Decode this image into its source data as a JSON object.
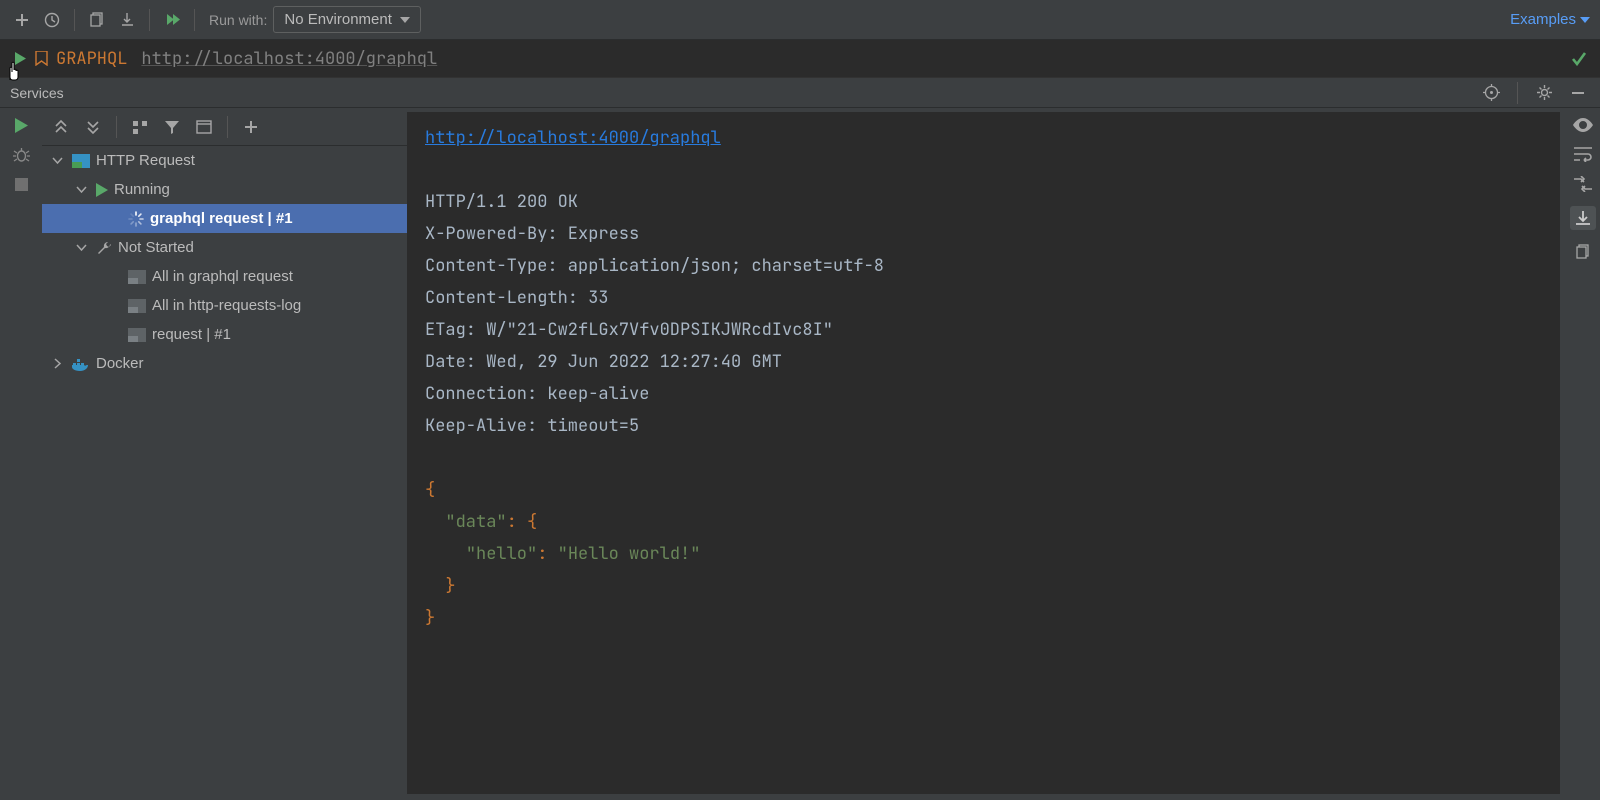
{
  "toolbar": {
    "run_with_label": "Run with:",
    "env_selected": "No Environment",
    "examples_label": "Examples"
  },
  "editor": {
    "method": "GRAPHQL",
    "url": "http://localhost:4000/graphql"
  },
  "services": {
    "title": "Services"
  },
  "tree": {
    "http_request": "HTTP Request",
    "running": "Running",
    "active_req": "graphql request  |  #1",
    "not_started": "Not Started",
    "ns_items": [
      "All in graphql request",
      "All in http-requests-log",
      "request  |  #1"
    ],
    "docker": "Docker"
  },
  "response": {
    "url": "http://localhost:4000/graphql",
    "headers": [
      "HTTP/1.1 200 OK",
      "X-Powered-By: Express",
      "Content-Type: application/json; charset=utf-8",
      "Content-Length: 33",
      "ETag: W/\"21-Cw2fLGx7Vfv0DPSIKJWRcdIvc8I\"",
      "Date: Wed, 29 Jun 2022 12:27:40 GMT",
      "Connection: keep-alive",
      "Keep-Alive: timeout=5"
    ],
    "json": {
      "key1": "\"data\"",
      "key2": "\"hello\"",
      "val2": "\"Hello world!\""
    }
  }
}
